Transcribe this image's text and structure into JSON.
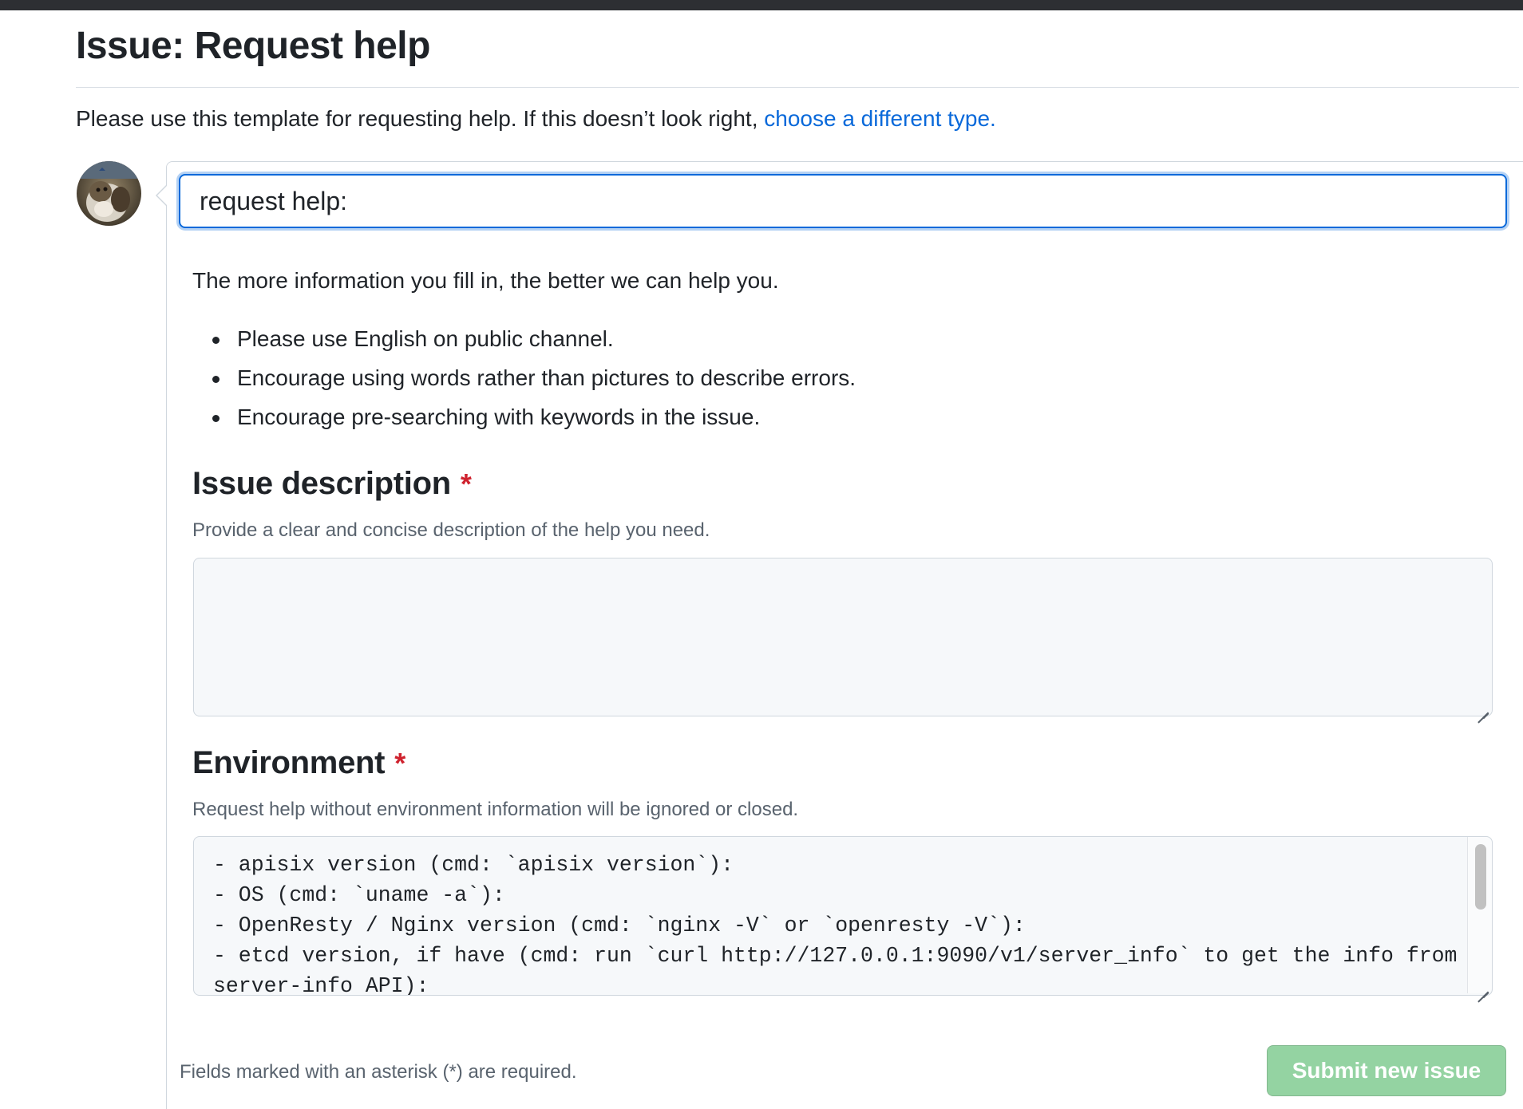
{
  "page": {
    "title": "Issue: Request help",
    "intro_text": "Please use this template for requesting help. If this doesn’t look right, ",
    "intro_link": "choose a different type."
  },
  "form": {
    "title_value": "request help:",
    "description": "The more information you fill in, the better we can help you.",
    "bullets": [
      "Please use English on public channel.",
      "Encourage using words rather than pictures to describe errors.",
      "Encourage pre-searching with keywords in the issue."
    ],
    "issue_description": {
      "label": "Issue description",
      "required_mark": "*",
      "hint": "Provide a clear and concise description of the help you need.",
      "value": ""
    },
    "environment": {
      "label": "Environment",
      "required_mark": "*",
      "hint": "Request help without environment information will be ignored or closed.",
      "value": "- apisix version (cmd: `apisix version`):\n- OS (cmd: `uname -a`):\n- OpenResty / Nginx version (cmd: `nginx -V` or `openresty -V`):\n- etcd version, if have (cmd: run `curl http://127.0.0.1:9090/v1/server_info` to get the info from\nserver-info API):"
    },
    "footer_note": "Fields marked with an asterisk (*) are required.",
    "submit_label": "Submit new issue"
  },
  "colors": {
    "link": "#0969da",
    "required": "#cf222e",
    "submit_disabled": "#94d3a2",
    "focus_border": "#0969da"
  }
}
